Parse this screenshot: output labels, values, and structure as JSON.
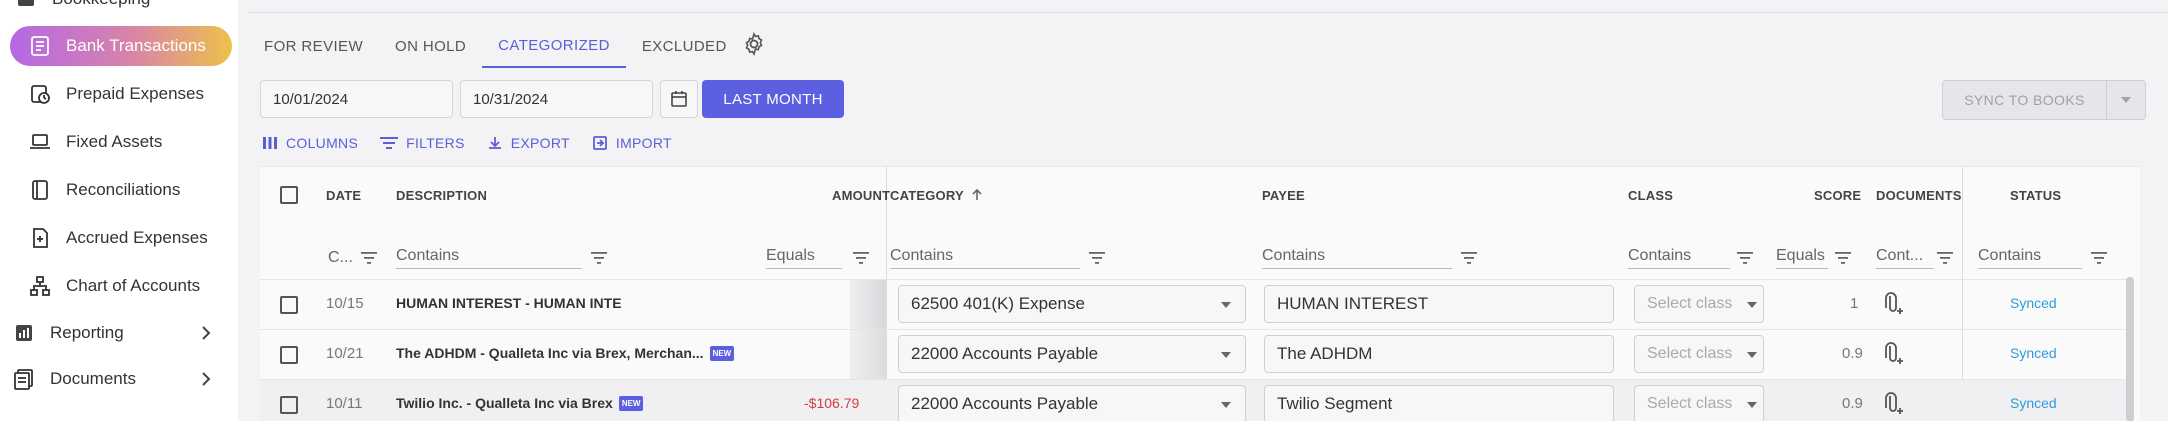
{
  "sidebar": {
    "top_partial": "Bookkeeping",
    "items": [
      {
        "label": "Bank Transactions",
        "icon": "list-icon",
        "active": true
      },
      {
        "label": "Prepaid Expenses",
        "icon": "calendar-clock-icon"
      },
      {
        "label": "Fixed Assets",
        "icon": "laptop-icon"
      },
      {
        "label": "Reconciliations",
        "icon": "book-icon"
      },
      {
        "label": "Accrued Expenses",
        "icon": "doc-plus-icon"
      },
      {
        "label": "Chart of Accounts",
        "icon": "hierarchy-icon"
      }
    ],
    "sections": [
      {
        "label": "Reporting",
        "icon": "report-icon"
      },
      {
        "label": "Documents",
        "icon": "documents-icon"
      }
    ]
  },
  "tabs": [
    {
      "label": "FOR REVIEW"
    },
    {
      "label": "ON HOLD"
    },
    {
      "label": "CATEGORIZED",
      "active": true
    },
    {
      "label": "EXCLUDED"
    }
  ],
  "dates": {
    "start": "10/01/2024",
    "end": "10/31/2024"
  },
  "last_month_label": "LAST MONTH",
  "sync_label": "SYNC TO BOOKS",
  "toolbar": {
    "columns": "COLUMNS",
    "filters": "FILTERS",
    "export": "EXPORT",
    "import": "IMPORT"
  },
  "columns": {
    "date": "DATE",
    "description": "DESCRIPTION",
    "amount": "AMOUNT",
    "category": "CATEGORY",
    "payee": "PAYEE",
    "class": "CLASS",
    "score": "SCORE",
    "documents": "DOCUMENTS",
    "status": "STATUS"
  },
  "filters": {
    "date": "C...",
    "description": "Contains",
    "amount": "Equals",
    "category": "Contains",
    "payee": "Contains",
    "class": "Contains",
    "score": "Equals",
    "documents": "Cont...",
    "status": "Contains"
  },
  "rows": [
    {
      "date": "10/15",
      "description": "HUMAN INTEREST - HUMAN INTE",
      "is_new": false,
      "amount": "",
      "category": "62500 401(K) Expense",
      "payee": "HUMAN INTEREST",
      "class_placeholder": "Select class",
      "score": "1",
      "status": "Synced"
    },
    {
      "date": "10/21",
      "description": "The ADHDM - Qualleta Inc via Brex, Merchan...",
      "is_new": true,
      "amount": "",
      "category": "22000 Accounts Payable",
      "payee": "The ADHDM",
      "class_placeholder": "Select class",
      "score": "0.9",
      "status": "Synced"
    },
    {
      "date": "10/11",
      "description": "Twilio Inc. - Qualleta Inc via Brex",
      "is_new": true,
      "amount": "-$106.79",
      "category": "22000 Accounts Payable",
      "payee": "Twilio Segment",
      "class_placeholder": "Select class",
      "score": "0.9",
      "status": "Synced"
    }
  ],
  "new_badge": "NEW",
  "colors": {
    "accent": "#5b5fe0",
    "synced": "#2d9cdb",
    "negative": "#d63b3b"
  }
}
